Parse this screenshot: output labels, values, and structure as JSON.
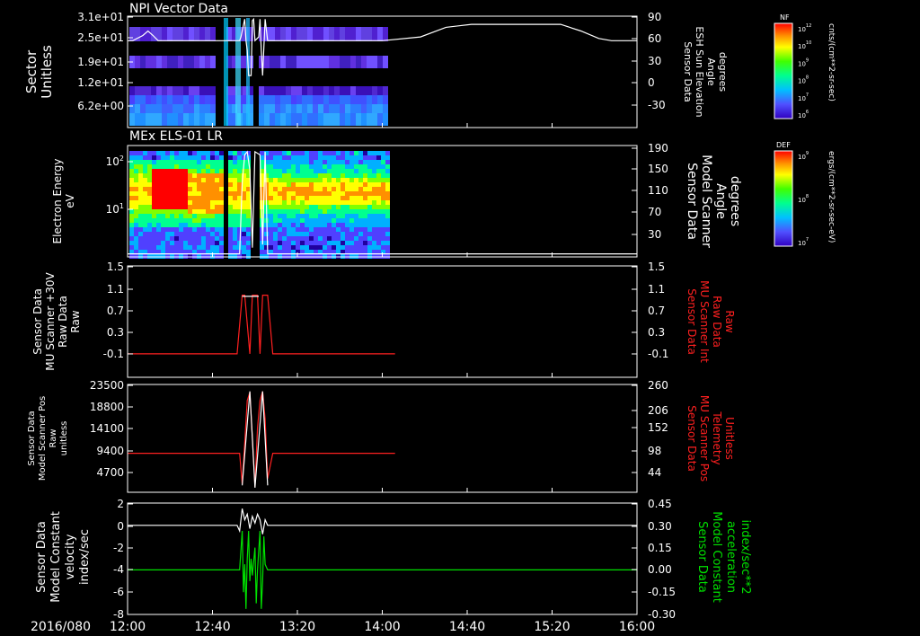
{
  "chart_data": [
    {
      "type": "heatmap",
      "title": "NPI Vector Data",
      "ylabel_left": [
        "Sector",
        "Unitless"
      ],
      "left_ticks": [
        "3.1e+01",
        "2.5e+01",
        "1.9e+01",
        "1.2e+01",
        "6.2e+00"
      ],
      "ylabel_right": [
        "Sensor Data",
        "ESH Sun Elevation",
        "Angle",
        "degrees"
      ],
      "right_ticks": [
        "90",
        "60",
        "30",
        "0",
        "-30"
      ],
      "right_ylim": [
        -60,
        90
      ],
      "overlay": {
        "name": "Sensor Data ESH Sun Elevation Angle",
        "color": "#ffffff",
        "points": [
          [
            0,
            57
          ],
          [
            2,
            57
          ],
          [
            6,
            64
          ],
          [
            8,
            70
          ],
          [
            10,
            64
          ],
          [
            12,
            57
          ],
          [
            35,
            57
          ],
          [
            44,
            57
          ],
          [
            44.5,
            62
          ],
          [
            46,
            86
          ],
          [
            46.5,
            57
          ],
          [
            47,
            44
          ],
          [
            47.5,
            10
          ],
          [
            48.5,
            10
          ],
          [
            49,
            84
          ],
          [
            49.5,
            86
          ],
          [
            50,
            57
          ],
          [
            51.5,
            62
          ],
          [
            52,
            86
          ],
          [
            52.5,
            44
          ],
          [
            53,
            10
          ],
          [
            54,
            86
          ],
          [
            55,
            57
          ],
          [
            68,
            57
          ],
          [
            100,
            57
          ],
          [
            115,
            62
          ],
          [
            125,
            75
          ],
          [
            135,
            79
          ],
          [
            160,
            79
          ],
          [
            170,
            79
          ],
          [
            178,
            70
          ],
          [
            185,
            60
          ],
          [
            190,
            57
          ],
          [
            200,
            57
          ]
        ]
      },
      "colorbar": {
        "label": "NF",
        "unit": "cnts/(cm**2-sr-sec)",
        "ticks": [
          "10^12",
          "10^10",
          "10^9",
          "10^8",
          "10^7",
          "10^6"
        ]
      }
    },
    {
      "type": "heatmap",
      "title": "MEx ELS-01 LR",
      "ylabel_left": [
        "Electron Energy",
        "eV"
      ],
      "left_ticks": [
        "10^2",
        "10^1"
      ],
      "ylabel_right": [
        "Sensor Data",
        "Model Scanner",
        "Angle",
        "degrees"
      ],
      "right_ticks": [
        "190",
        "150",
        "110",
        "70",
        "30"
      ],
      "right_ylim": [
        10,
        190
      ],
      "overlay": {
        "name": "Sensor Data Model Scanner Angle",
        "color": "#ffffff",
        "points": [
          [
            0,
            15
          ],
          [
            44,
            15
          ],
          [
            45,
            130
          ],
          [
            46,
            175
          ],
          [
            47,
            180
          ],
          [
            48,
            150
          ],
          [
            49,
            25
          ],
          [
            50,
            180
          ],
          [
            52,
            175
          ],
          [
            53,
            30
          ],
          [
            54,
            180
          ],
          [
            55,
            15
          ],
          [
            100,
            15
          ],
          [
            200,
            15
          ]
        ]
      },
      "colorbar": {
        "label": "DEF",
        "unit": "ergs/(cm**2-sr-sec-eV)",
        "ticks": [
          "10^9",
          "10^8",
          "10^7"
        ]
      }
    },
    {
      "type": "line",
      "ylabel_left": [
        "Sensor Data",
        "MU Scanner +30V",
        "Raw Data",
        "Raw"
      ],
      "left_ticks": [
        "1.5",
        "1.1",
        "0.7",
        "0.3",
        "-0.1"
      ],
      "ylim": [
        -0.4,
        1.5
      ],
      "ylabel_right": [
        "Sensor Data",
        "MU Scanner Int",
        "Raw Data",
        "Raw"
      ],
      "right_ticks": [
        "1.5",
        "1.1",
        "0.7",
        "0.3",
        "-0.1"
      ],
      "series": [
        {
          "name": "Sensor Data MU Scanner Int Raw Data",
          "color": "#ff2020",
          "points": [
            [
              0,
              0
            ],
            [
              43,
              0
            ],
            [
              45,
              1
            ],
            [
              46,
              1
            ],
            [
              48,
              0
            ],
            [
              49,
              1
            ],
            [
              51,
              1
            ],
            [
              52,
              0
            ],
            [
              53,
              1
            ],
            [
              55,
              1
            ],
            [
              57,
              0
            ],
            [
              105,
              0
            ]
          ]
        },
        {
          "color": "#ffffff",
          "points": [
            [
              45,
              0.98
            ],
            [
              49,
              0.98
            ],
            [
              50.5,
              0.98
            ],
            [
              51.5,
              0.98
            ]
          ]
        }
      ]
    },
    {
      "type": "line",
      "ylabel_left": [
        "Sensor Data",
        "Model Scanner Pos",
        "Raw",
        "unitless"
      ],
      "left_ticks": [
        "23500",
        "18800",
        "14100",
        "9400",
        "4700"
      ],
      "ylim": [
        0,
        23500
      ],
      "ylabel_right": [
        "Sensor Data",
        "MU Scanner Pos",
        "Telemetry",
        "Unitless"
      ],
      "right_ticks": [
        "260",
        "206",
        "152",
        "98",
        "44"
      ],
      "series": [
        {
          "name": "Sensor Data MU Scanner Pos Telemetry",
          "color": "#ff2020",
          "points": [
            [
              0,
              8500
            ],
            [
              44,
              8500
            ],
            [
              45,
              1800
            ],
            [
              47,
              20000
            ],
            [
              48,
              21800
            ],
            [
              49,
              12000
            ],
            [
              50,
              1200
            ],
            [
              51,
              14000
            ],
            [
              52,
              20000
            ],
            [
              53,
              22000
            ],
            [
              54,
              16000
            ],
            [
              55,
              3000
            ],
            [
              57,
              8500
            ],
            [
              105,
              8500
            ]
          ]
        },
        {
          "name": "Sensor Data Model Scanner Pos Raw",
          "color": "#ffffff",
          "points": [
            [
              45,
              1500
            ],
            [
              48,
              22000
            ],
            [
              50,
              1000
            ],
            [
              53,
              22000
            ],
            [
              55,
              1500
            ]
          ]
        }
      ]
    },
    {
      "type": "line",
      "ylabel_left": [
        "Sensor Data",
        "Model Constant",
        "velocity",
        "index/sec"
      ],
      "left_ticks": [
        "2",
        "0",
        "-2",
        "-4",
        "-6",
        "-8"
      ],
      "ylim": [
        -8,
        2
      ],
      "ylabel_right": [
        "Sensor Data",
        "Model Constant",
        "acceleration",
        "index/sec**2"
      ],
      "right_ticks": [
        "0.45",
        "0.30",
        "0.15",
        "0.00",
        "-0.15",
        "-0.30"
      ],
      "series": [
        {
          "name": "Sensor Data Model Constant velocity",
          "color": "#ffffff",
          "points": [
            [
              0,
              0
            ],
            [
              43,
              0
            ],
            [
              44,
              -0.5
            ],
            [
              45,
              1.5
            ],
            [
              46,
              0.5
            ],
            [
              47,
              1
            ],
            [
              48,
              -0.3
            ],
            [
              49,
              0.8
            ],
            [
              50,
              0.2
            ],
            [
              51,
              1
            ],
            [
              52,
              0.5
            ],
            [
              53,
              -0.8
            ],
            [
              54,
              0.5
            ],
            [
              55,
              0
            ],
            [
              100,
              0
            ],
            [
              200,
              0
            ]
          ]
        },
        {
          "name": "Sensor Data Model Constant acceleration",
          "color": "#00e000",
          "points": [
            [
              0,
              -4
            ],
            [
              44,
              -4
            ],
            [
              45,
              -0.5
            ],
            [
              45.5,
              -6
            ],
            [
              46,
              -3.5
            ],
            [
              46.5,
              -7.5
            ],
            [
              47,
              -3
            ],
            [
              47.5,
              -0.5
            ],
            [
              48,
              -5
            ],
            [
              48.5,
              -3
            ],
            [
              49,
              -4.5
            ],
            [
              50,
              -2
            ],
            [
              50.5,
              -7
            ],
            [
              51,
              -4
            ],
            [
              52,
              -0.5
            ],
            [
              52.5,
              -7.5
            ],
            [
              53,
              -5
            ],
            [
              53.5,
              -1
            ],
            [
              54,
              -3.5
            ],
            [
              55,
              -4
            ],
            [
              200,
              -4
            ]
          ]
        }
      ]
    }
  ],
  "time_axis": {
    "date": "2016/080",
    "labels": [
      "12:00",
      "12:40",
      "13:20",
      "14:00",
      "14:40",
      "15:20",
      "16:00"
    ]
  },
  "colors": {
    "background": "#000000",
    "axis": "#ffffff",
    "red_label": "#ff2020",
    "green_label": "#00e000"
  }
}
